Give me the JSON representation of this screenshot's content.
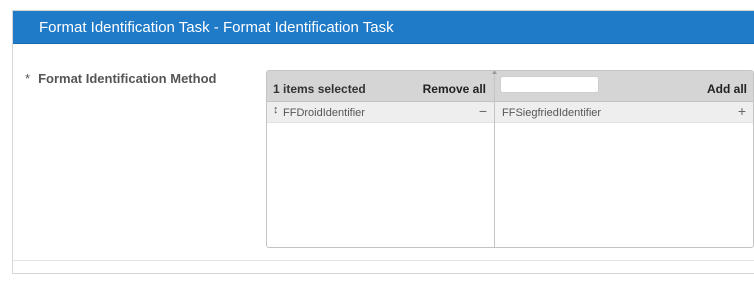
{
  "panel": {
    "title": "Format Identification Task - Format Identification Task"
  },
  "field": {
    "required_marker": "*",
    "label": "Format Identification Method"
  },
  "multiselect": {
    "selected_count_text": "1 items selected",
    "remove_all_label": "Remove all",
    "add_all_label": "Add all",
    "search": {
      "value": "",
      "placeholder": ""
    },
    "selected_items": [
      {
        "label": "FFDroidIdentifier",
        "drag_icon": "↕",
        "action_icon": "−"
      }
    ],
    "available_items": [
      {
        "label": "FFSiegfriedIdentifier",
        "action_icon": "+"
      }
    ]
  },
  "colors": {
    "header_bg": "#1f7ac8",
    "list_header_bg": "#d5d5d5",
    "item_bg": "#eeeeee"
  }
}
